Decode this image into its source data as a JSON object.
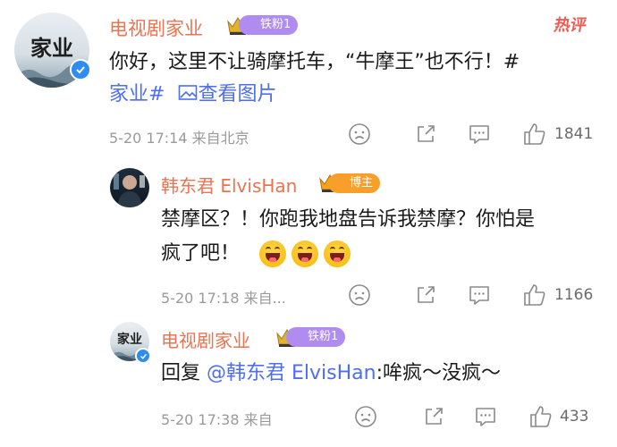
{
  "hot_label": "热评",
  "comments": [
    {
      "user": "电视剧家业",
      "avatar_text": "家业",
      "badge": "铁粉1",
      "text_line1": "你好，这里不让骑摩托车，“牛摩王”也不行！#",
      "text_line2_tag": "家业#",
      "text_line2_link": "查看图片",
      "meta": "5-20 17:14  来自北京",
      "like_count": "1841"
    },
    {
      "user": "韩东君 ElvisHan",
      "badge": "博主",
      "text_line1": "禁摩区？！你跑我地盘告诉我禁摩？你怕是",
      "text_line2": "疯了吧！",
      "meta": "5-20 17:18  来自...",
      "like_count": "1166"
    },
    {
      "user": "电视剧家业",
      "avatar_text": "家业",
      "badge": "铁粉1",
      "reply_prefix": "回复",
      "reply_mention": "@韩东君 ElvisHan",
      "reply_text": ":哞疯～没疯～",
      "meta": "5-20 17:38  来自",
      "like_count": "433"
    }
  ],
  "colors": {
    "username": "#eb7350",
    "link": "#4e6ef2",
    "hot": "#f25a54",
    "meta": "#9a9a9a"
  },
  "icons": [
    "verified-icon",
    "crown-icon",
    "image-icon",
    "sad-face-icon",
    "share-icon",
    "comment-icon",
    "like-icon",
    "grin-emoji"
  ]
}
